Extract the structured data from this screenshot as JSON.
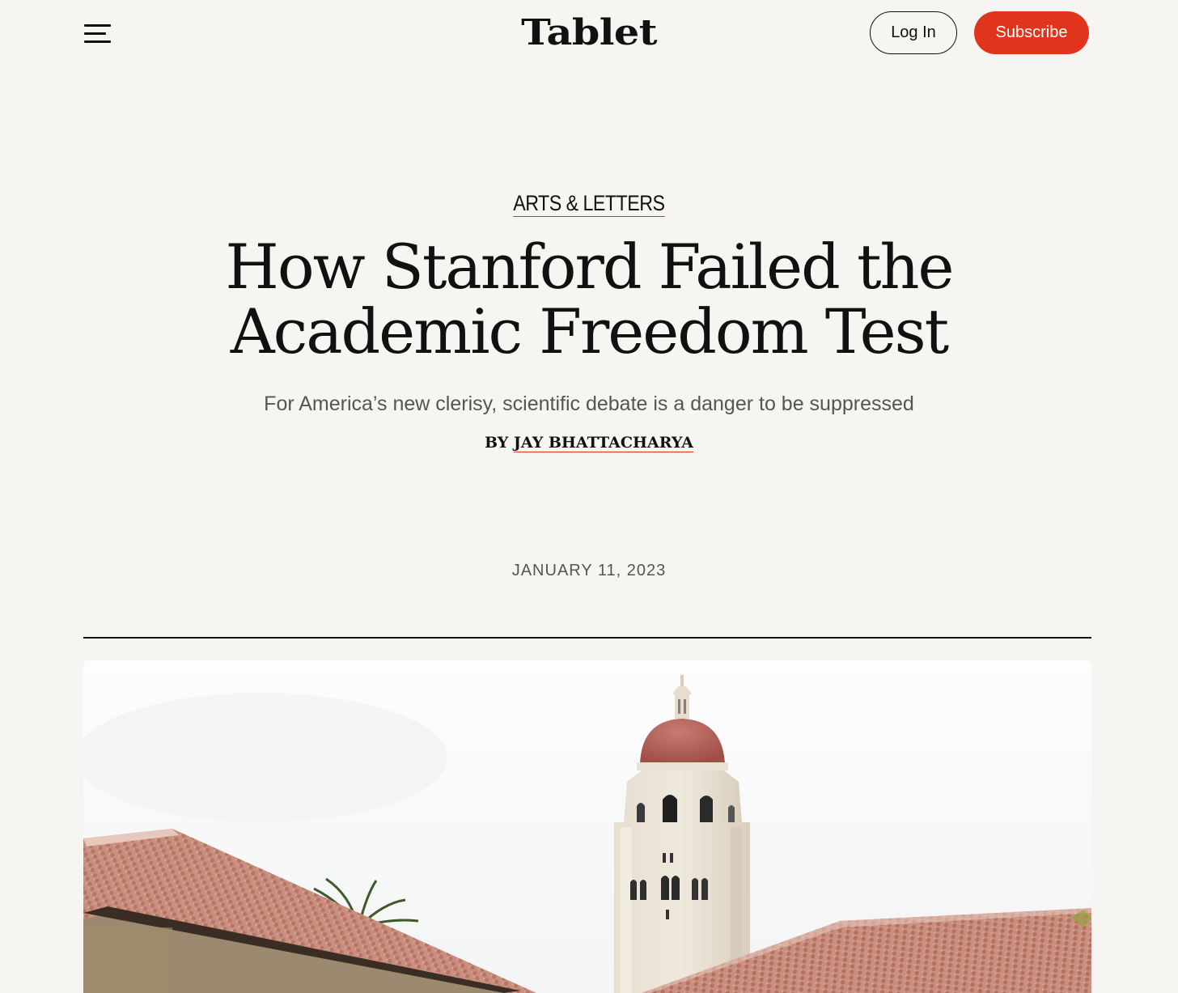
{
  "header": {
    "logo": "Tablet",
    "login_label": "Log In",
    "subscribe_label": "Subscribe",
    "accent_color": "#e0341d"
  },
  "article": {
    "category": "ARTS & LETTERS",
    "title": "How Stanford Failed the Academic Freedom Test",
    "dek": "For America’s new clerisy, scientific debate is a danger to be suppressed",
    "byline_prefix": "BY",
    "author": "JAY BHATTACHARYA",
    "date": "JANUARY 11, 2023"
  },
  "hero_image": {
    "subject": "hoover-tower-with-tiled-roofs"
  }
}
